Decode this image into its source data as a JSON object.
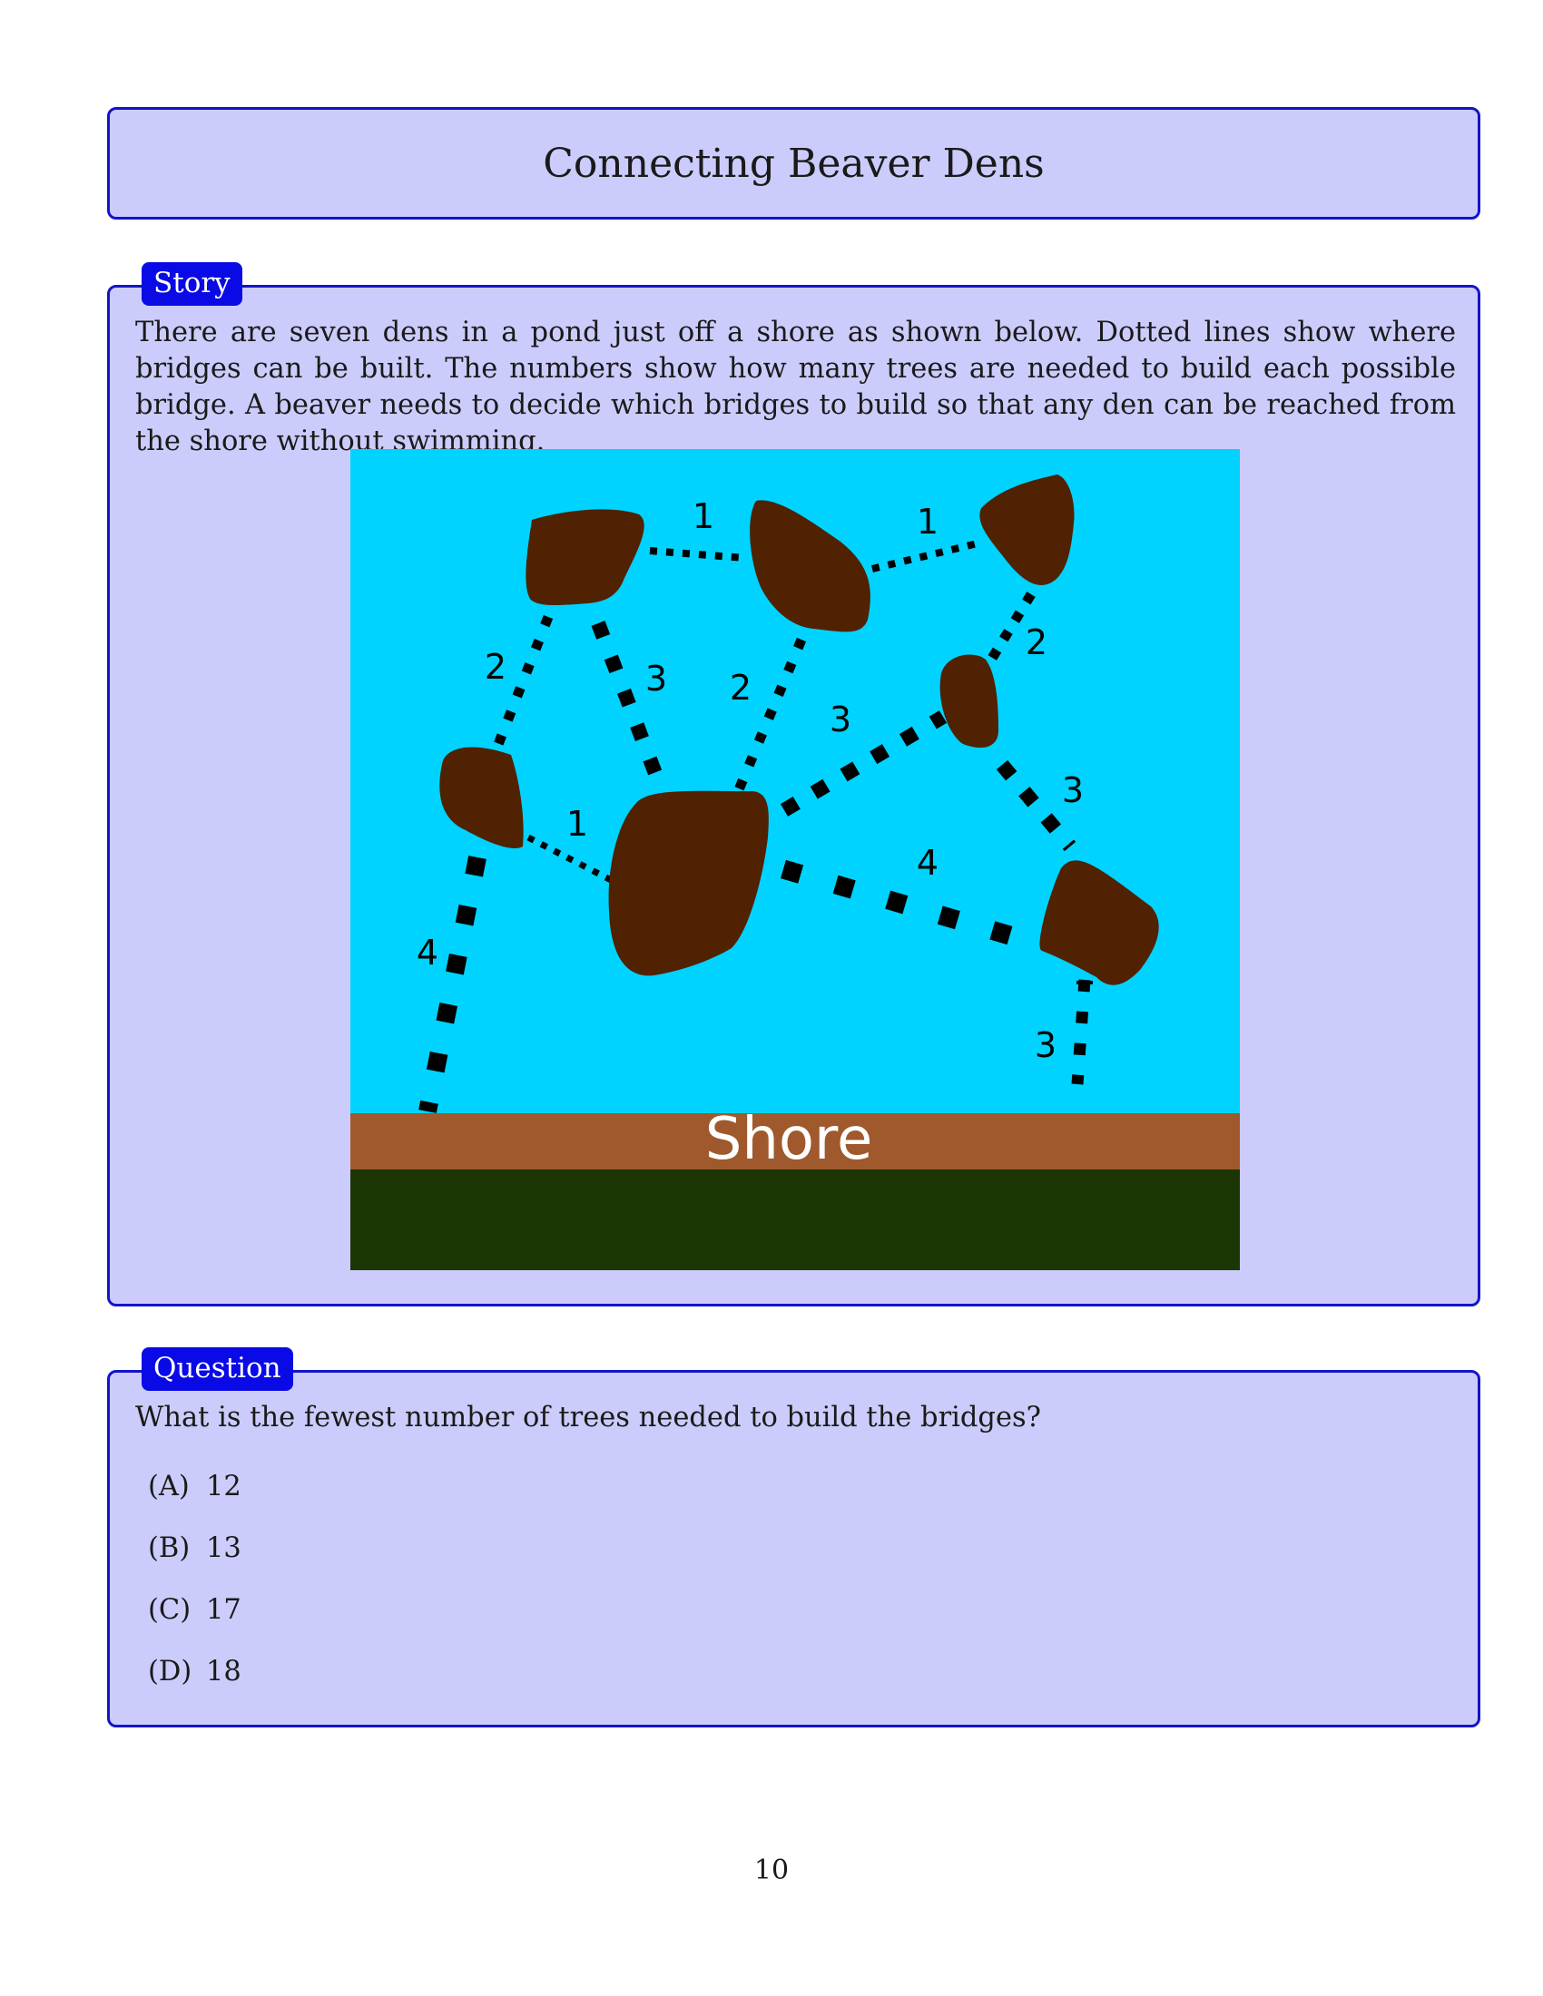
{
  "title": "Connecting Beaver Dens",
  "story": {
    "tag": "Story",
    "text": "There are seven dens in a pond just off a shore as shown below. Dotted lines show where bridges can be built. The numbers show how many trees are needed to build each possible bridge. A beaver needs to decide which bridges to build so that any den can be reached from the shore without swimming."
  },
  "figure": {
    "shore_label": "Shore",
    "colors": {
      "water": "#00d3ff",
      "shore": "#a0592c",
      "land": "#1c3504",
      "den": "#502201",
      "bridge": "#000000"
    },
    "bridge_costs": {
      "top_left_to_top_middle": "1",
      "top_middle_to_top_right": "1",
      "top_left_to_left": "2",
      "top_left_to_big_center": "3",
      "top_middle_to_big_center": "2",
      "big_center_to_small_right": "3",
      "top_right_to_small_right": "2",
      "left_to_big_center": "1",
      "small_right_to_bottom_right": "3",
      "big_center_to_bottom_right": "4",
      "left_to_shore": "4",
      "bottom_right_to_shore": "3"
    }
  },
  "question": {
    "tag": "Question",
    "text": "What is the fewest number of trees needed to build the bridges?",
    "options": [
      {
        "letter": "(A)",
        "value": "12"
      },
      {
        "letter": "(B)",
        "value": "13"
      },
      {
        "letter": "(C)",
        "value": "17"
      },
      {
        "letter": "(D)",
        "value": "18"
      }
    ]
  },
  "page_number": "10"
}
